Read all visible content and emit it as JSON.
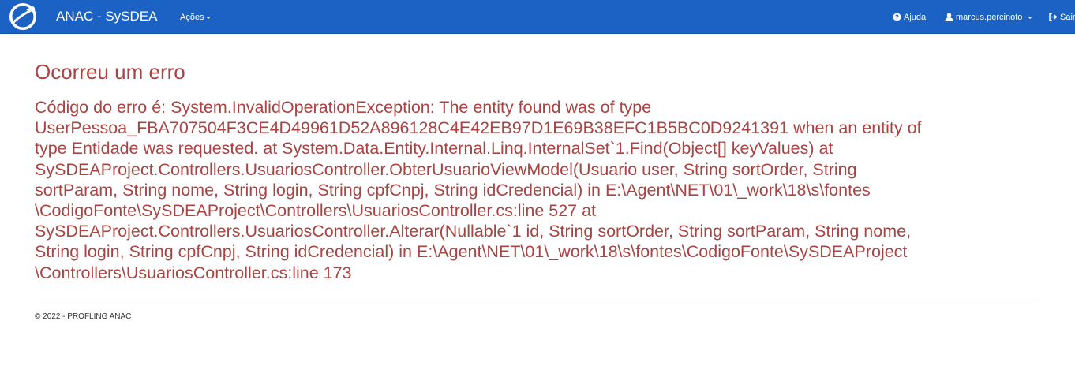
{
  "navbar": {
    "brand": "ANAC - SySDEA",
    "acoes_label": "Ações",
    "help_label": "Ajuda",
    "user_label": "marcus.percinoto",
    "logout_label": "Sair",
    "bg_color": "#1c61c4"
  },
  "error": {
    "title": "Ocorreu um erro",
    "message_lines": [
      "Código do erro é: System.InvalidOperationException: The entity found was of type",
      "UserPessoa_FBA707504F3CE4D49961D52A896128C4E42EB97D1E69B38EFC1B5BC0D9241391 when an entity of",
      "type Entidade was requested. at System.Data.Entity.Internal.Linq.InternalSet`1.Find(Object[] keyValues) at",
      "SySDEAProject.Controllers.UsuariosController.ObterUsuarioViewModel(Usuario user, String sortOrder, String",
      "sortParam, String nome, String login, String cpfCnpj, String idCredencial) in E:\\Agent\\NET\\01\\_work\\18\\s\\fontes",
      "\\CodigoFonte\\SySDEAProject\\Controllers\\UsuariosController.cs:line 527 at",
      "SySDEAProject.Controllers.UsuariosController.Alterar(Nullable`1 id, String sortOrder, String sortParam, String nome,",
      "String login, String cpfCnpj, String idCredencial) in E:\\Agent\\NET\\01\\_work\\18\\s\\fontes\\CodigoFonte\\SySDEAProject",
      "\\Controllers\\UsuariosController.cs:line 173"
    ],
    "color": "#a94442"
  },
  "footer": {
    "text": "© 2022 - PROFLING ANAC"
  }
}
